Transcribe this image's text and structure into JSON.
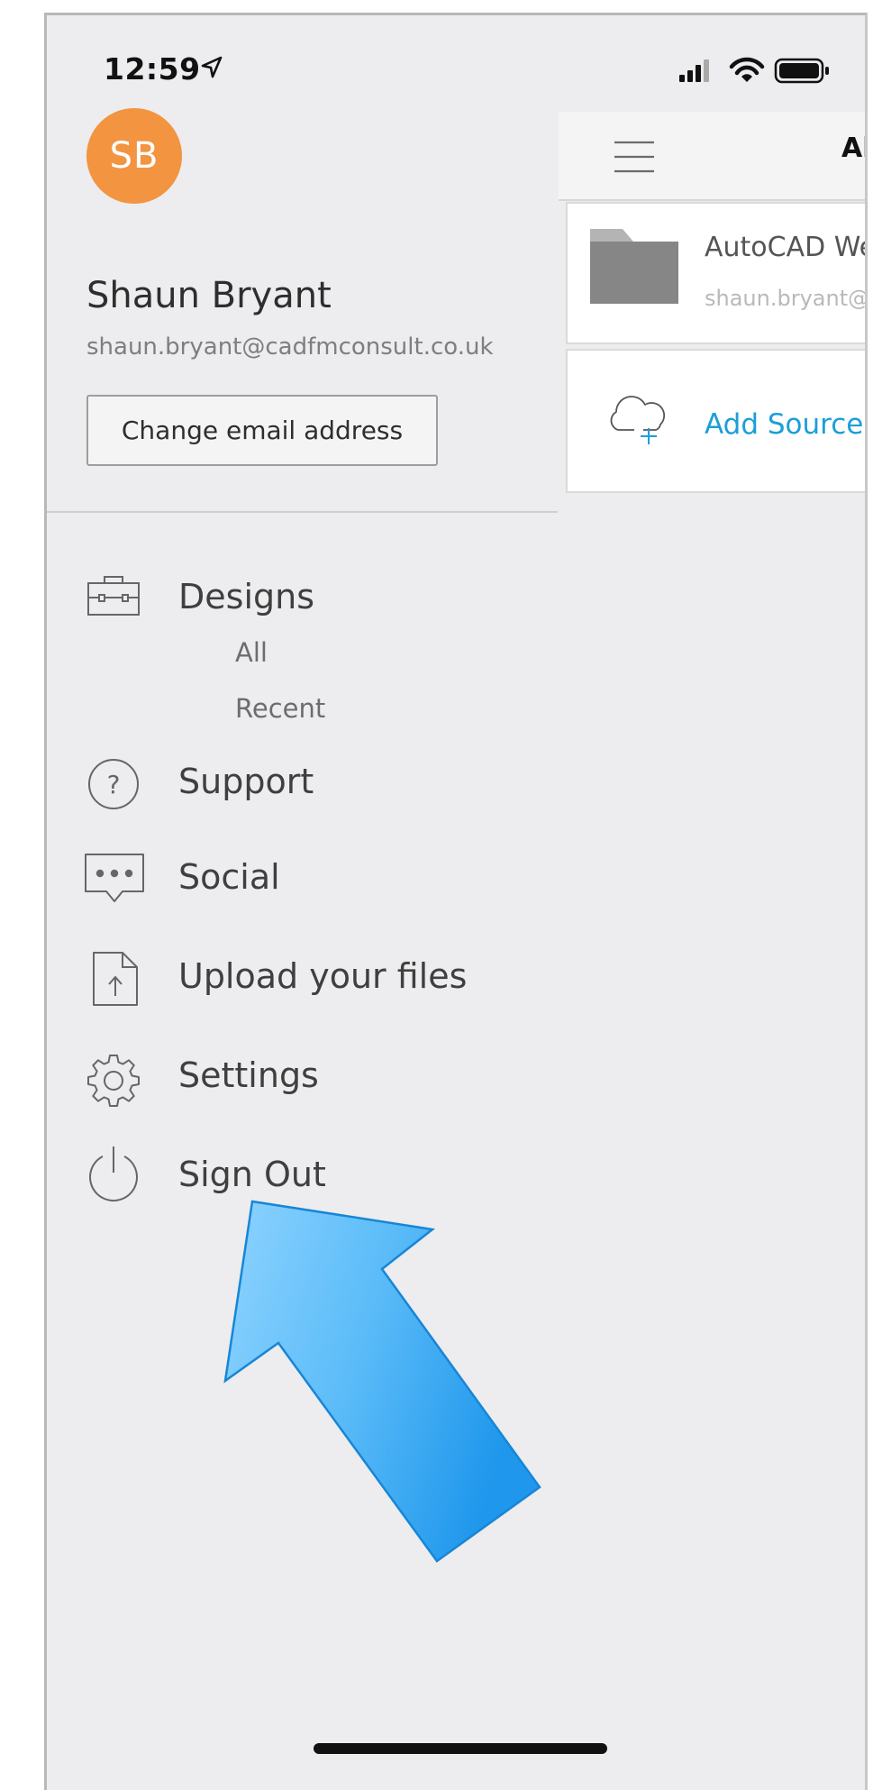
{
  "status_bar": {
    "time": "12:59"
  },
  "profile": {
    "initials": "SB",
    "name": "Shaun Bryant",
    "email": "shaun.bryant@cadfmconsult.co.uk",
    "change_email_label": "Change email address",
    "avatar_color": "#f39440"
  },
  "menu": {
    "designs": {
      "label": "Designs",
      "sub_items": [
        "All",
        "Recent"
      ]
    },
    "support": "Support",
    "social": "Social",
    "upload": "Upload your files",
    "settings": "Settings",
    "sign_out": "Sign Out"
  },
  "right_panel": {
    "title_partial": "Al",
    "sources": [
      {
        "title": "AutoCAD We",
        "subtitle": "shaun.bryant@"
      }
    ],
    "add_source_label": "Add Source",
    "accent_color": "#1a9fd8"
  },
  "annotation": {
    "arrow_color": "#2fa4f0"
  }
}
